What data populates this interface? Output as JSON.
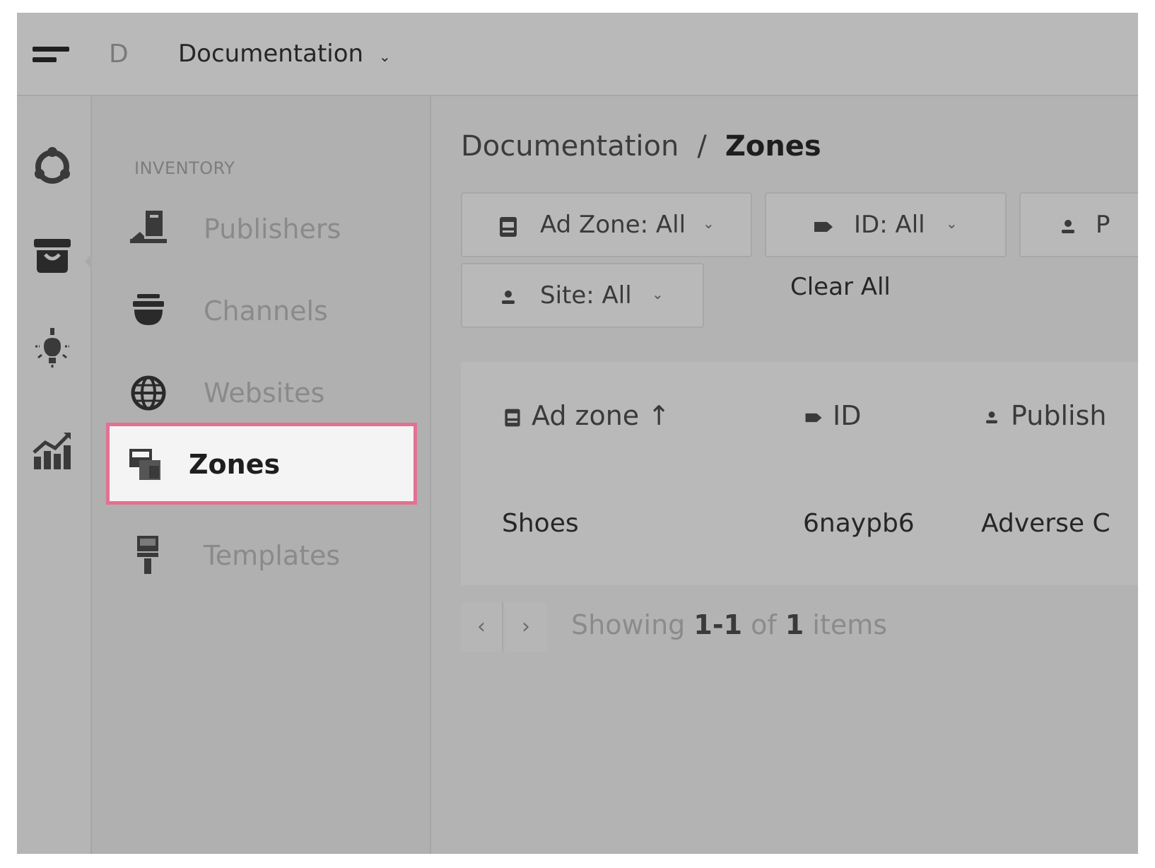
{
  "header": {
    "org_initial": "D",
    "org_name": "Documentation",
    "org_chevron": "⌄"
  },
  "rail": {
    "icons": [
      "integrations-icon",
      "inventory-icon",
      "ideas-bulb-icon",
      "reports-chart-icon"
    ]
  },
  "subnav": {
    "heading": "INVENTORY",
    "items": [
      {
        "label": "Publishers",
        "icon": "publishers-icon"
      },
      {
        "label": "Channels",
        "icon": "channels-icon"
      },
      {
        "label": "Websites",
        "icon": "websites-globe-icon"
      },
      {
        "label": "Zones",
        "icon": "zones-icon",
        "active": true
      },
      {
        "label": "Templates",
        "icon": "templates-icon"
      }
    ]
  },
  "breadcrumb": {
    "parent": "Documentation",
    "separator": "/",
    "current": "Zones"
  },
  "filters": {
    "ad_zone": "Ad Zone: All",
    "id": "ID: All",
    "publisher_partial": "P",
    "site": "Site: All",
    "clear_all": "Clear All"
  },
  "table": {
    "headers": {
      "ad_zone": "Ad zone ↑",
      "id": "ID",
      "publisher": "Publish"
    },
    "rows": [
      {
        "ad_zone": "Shoes",
        "id": "6naypb6",
        "publisher": "Adverse C"
      }
    ]
  },
  "pager": {
    "prev": "‹",
    "next": "›",
    "showing": "Showing",
    "range": "1-1",
    "of": "of",
    "total": "1",
    "items": "items"
  },
  "colors": {
    "active_border": "#e27192",
    "overlay_gray": "#b3b3b3"
  }
}
